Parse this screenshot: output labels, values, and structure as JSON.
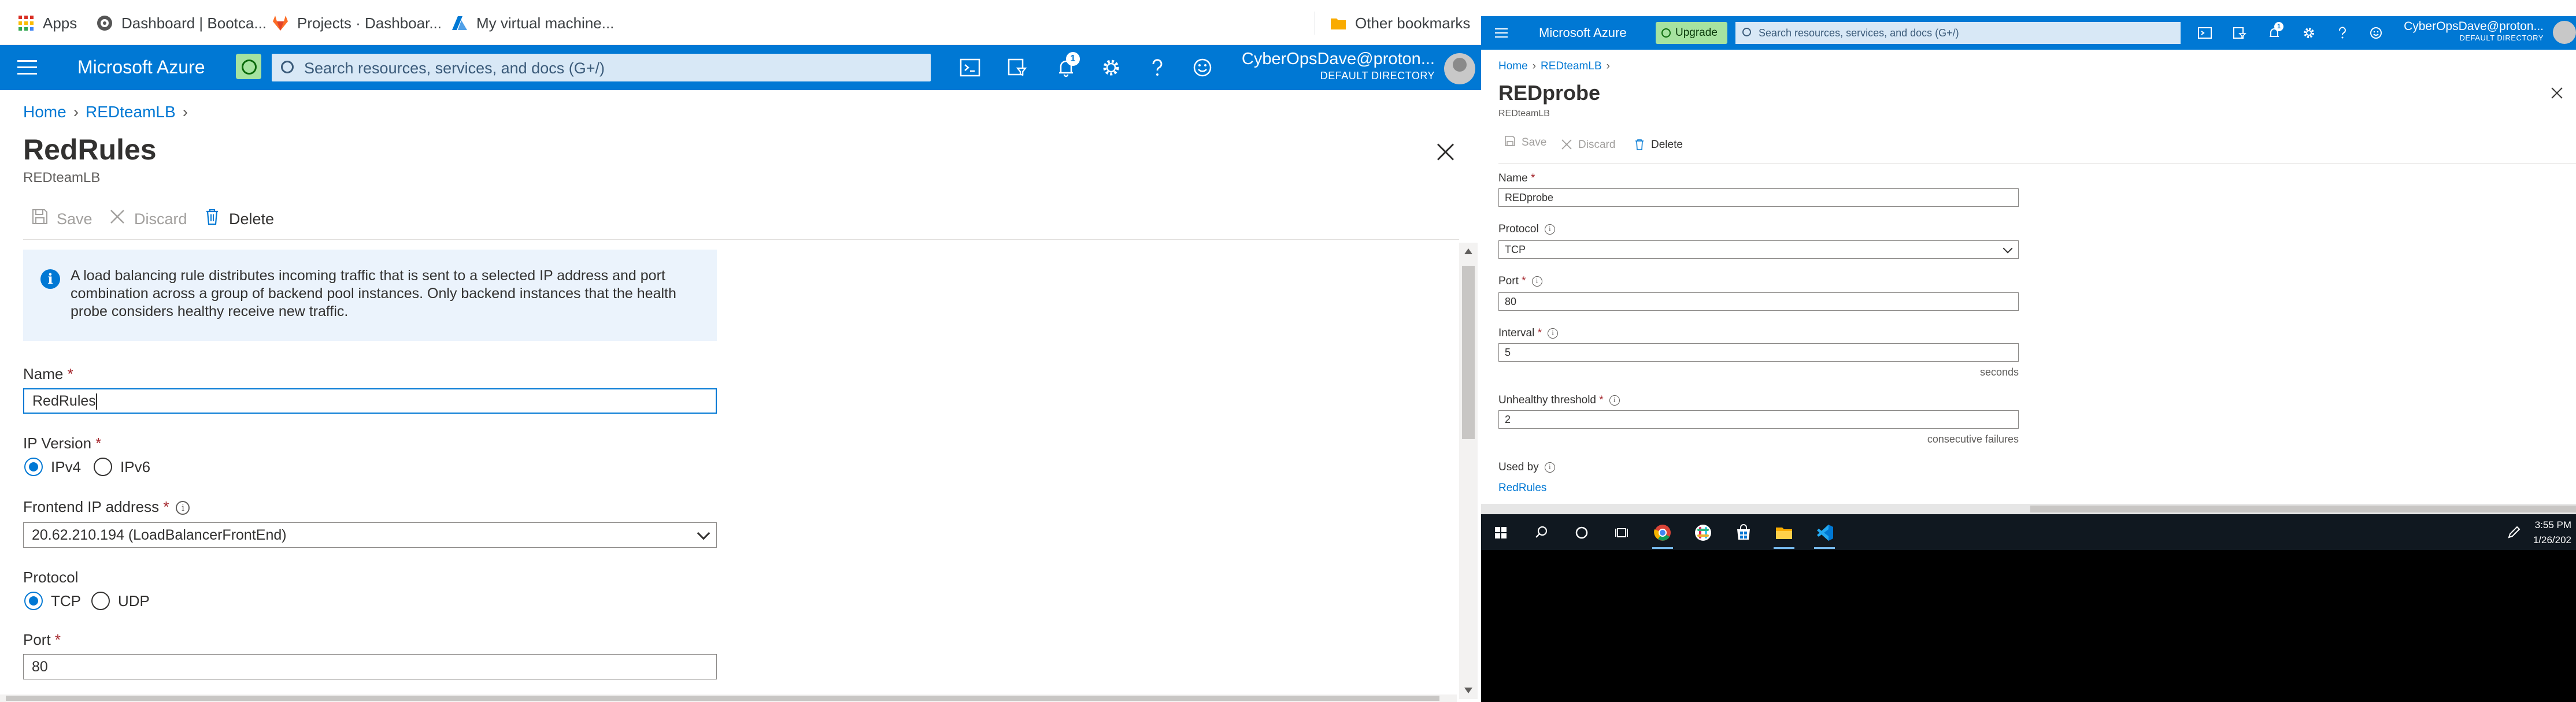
{
  "left": {
    "bookmarks": [
      {
        "label": "Apps",
        "icon": "apps-grid-icon"
      },
      {
        "label": "Dashboard | Bootca...",
        "icon": "site-favicon"
      },
      {
        "label": "Projects · Dashboar...",
        "icon": "gitlab-icon"
      },
      {
        "label": "My virtual machine...",
        "icon": "azure-icon"
      }
    ],
    "other_bookmarks": "Other bookmarks",
    "topbar": {
      "brand": "Microsoft Azure",
      "search_placeholder": "Search resources, services, and docs (G+/)",
      "notif_count": "1",
      "user_name": "CyberOpsDave@proton...",
      "directory": "DEFAULT DIRECTORY"
    },
    "breadcrumb": {
      "home": "Home",
      "lb": "REDteamLB"
    },
    "title": "RedRules",
    "subtitle": "REDteamLB",
    "commands": {
      "save": "Save",
      "discard": "Discard",
      "delete": "Delete"
    },
    "info_text": "A load balancing rule distributes incoming traffic that is sent to a selected IP address and port combination across a group of backend pool instances. Only backend instances that the health probe considers healthy receive new traffic.",
    "form": {
      "name_label": "Name",
      "name_value": "RedRules",
      "ipversion_label": "IP Version",
      "ipv4": "IPv4",
      "ipv6": "IPv6",
      "frontend_label": "Frontend IP address",
      "frontend_value": "20.62.210.194 (LoadBalancerFrontEnd)",
      "protocol_label": "Protocol",
      "tcp": "TCP",
      "udp": "UDP",
      "port_label": "Port",
      "port_value": "80",
      "required_mark": "*"
    }
  },
  "right": {
    "topbar": {
      "brand": "Microsoft Azure",
      "upgrade": "Upgrade",
      "search_placeholder": "Search resources, services, and docs (G+/)",
      "notif_count": "1",
      "user_name": "CyberOpsDave@proton...",
      "directory": "DEFAULT DIRECTORY"
    },
    "breadcrumb": {
      "home": "Home",
      "lb": "REDteamLB"
    },
    "title": "REDprobe",
    "subtitle": "REDteamLB",
    "commands": {
      "save": "Save",
      "discard": "Discard",
      "delete": "Delete"
    },
    "form": {
      "name_label": "Name",
      "name_value": "REDprobe",
      "protocol_label": "Protocol",
      "protocol_value": "TCP",
      "port_label": "Port",
      "port_value": "80",
      "interval_label": "Interval",
      "interval_value": "5",
      "interval_suffix": "seconds",
      "threshold_label": "Unhealthy threshold",
      "threshold_value": "2",
      "threshold_suffix": "consecutive failures",
      "usedby_label": "Used by",
      "usedby_link": "RedRules",
      "required_mark": "*"
    },
    "clock": {
      "time": "3:55 PM",
      "date": "1/26/202"
    }
  },
  "colors": {
    "azure_blue": "#0078d4",
    "info_bg": "#ebf3fc",
    "required": "#a4262c"
  }
}
